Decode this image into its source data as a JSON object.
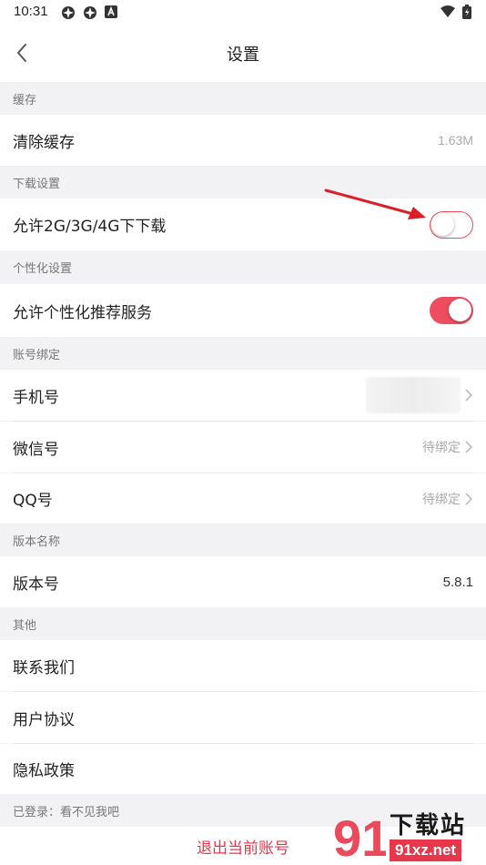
{
  "status_bar": {
    "time": "10:31"
  },
  "nav": {
    "title": "设置"
  },
  "sections": {
    "cache": {
      "header": "缓存",
      "clear_cache_label": "清除缓存",
      "cache_size": "1.63M"
    },
    "download": {
      "header": "下载设置",
      "mobile_download_label": "允许2G/3G/4G下下载",
      "mobile_download_enabled": false
    },
    "personalization": {
      "header": "个性化设置",
      "recommend_label": "允许个性化推荐服务",
      "recommend_enabled": true
    },
    "account": {
      "header": "账号绑定",
      "phone_label": "手机号",
      "wechat_label": "微信号",
      "wechat_value": "待绑定",
      "qq_label": "QQ号",
      "qq_value": "待绑定"
    },
    "version": {
      "header": "版本名称",
      "version_label": "版本号",
      "version_value": "5.8.1"
    },
    "other": {
      "header": "其他",
      "contact_label": "联系我们",
      "agreement_label": "用户协议",
      "privacy_label": "隐私政策"
    }
  },
  "login_status": "已登录：看不见我吧",
  "logout_label": "退出当前账号",
  "watermark": {
    "title": "下载站",
    "url": "91xz.net",
    "logo_number": "91"
  },
  "colors": {
    "accent": "#ee4d5f",
    "logout": "#e8364a",
    "annotation_arrow": "#d9202a"
  },
  "icons": [
    "back-arrow-icon",
    "chevron-right-icon",
    "wifi-icon",
    "battery-icon",
    "app-notification-icon"
  ]
}
